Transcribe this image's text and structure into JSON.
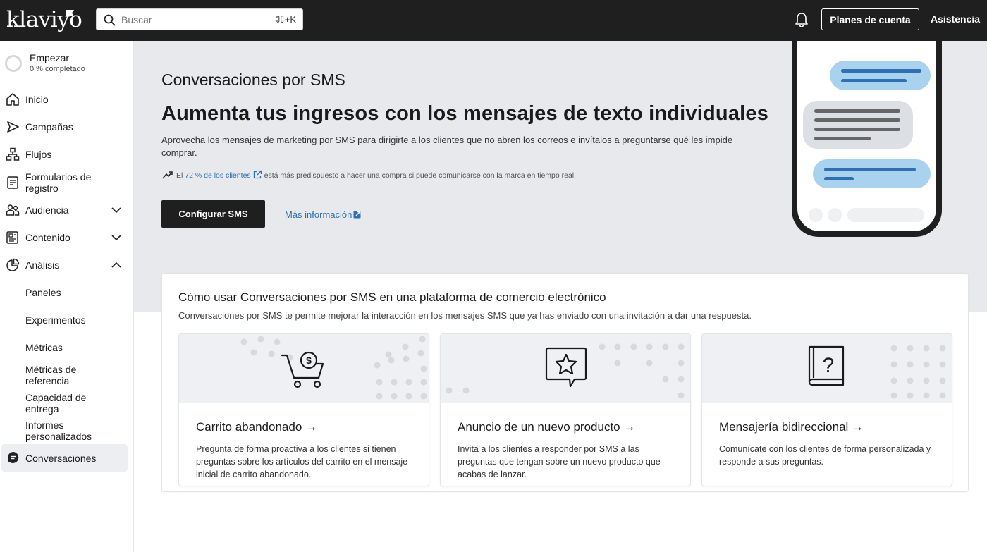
{
  "topbar": {
    "logo": "klaviyo",
    "search_placeholder": "Buscar",
    "search_shortcut": "⌘+K",
    "plans_label": "Planes de cuenta",
    "help_label": "Asistencia"
  },
  "sidebar": {
    "start_title": "Empezar",
    "start_progress": "0 % completado",
    "items": [
      {
        "label": "Inicio"
      },
      {
        "label": "Campañas"
      },
      {
        "label": "Flujos"
      },
      {
        "label": "Formularios de registro"
      },
      {
        "label": "Audiencia"
      },
      {
        "label": "Contenido"
      },
      {
        "label": "Análisis"
      }
    ],
    "sub_items": [
      {
        "label": "Paneles"
      },
      {
        "label": "Experimentos"
      },
      {
        "label": "Métricas"
      },
      {
        "label": "Métricas de referencia"
      },
      {
        "label": "Capacidad de entrega"
      },
      {
        "label": "Informes personalizados"
      }
    ],
    "active_item": "Conversaciones"
  },
  "hero": {
    "subtitle": "Conversaciones por SMS",
    "title": "Aumenta tus ingresos con los mensajes de texto individuales",
    "description": "Aprovecha los mensajes de marketing por SMS para dirigirte a los clientes que no abren los correos e invítalos a preguntarse qué les impide comprar.",
    "stat_prefix": "El",
    "stat_link": "72 % de los clientes",
    "stat_suffix": "está más predispuesto a hacer una compra si puede comunicarse con la marca en tiempo real.",
    "cta_label": "Configurar SMS",
    "more_label": "Más información"
  },
  "howto": {
    "title": "Cómo usar Conversaciones por SMS en una plataforma de comercio electrónico",
    "description": "Conversaciones por SMS te permite mejorar la interacción en los mensajes SMS que ya has enviado con una invitación a dar una respuesta.",
    "cards": [
      {
        "title": "Carrito abandonado →",
        "description": "Pregunta de forma proactiva a los clientes si tienen preguntas sobre los artículos del carrito en el mensaje inicial de carrito abandonado.",
        "icon": "cart-dollar-icon"
      },
      {
        "title": "Anuncio de un nuevo producto →",
        "description": "Invita a los clientes a responder por SMS a las preguntas que tengan sobre un nuevo producto que acabas de lanzar.",
        "icon": "star-message-icon"
      },
      {
        "title": "Mensajería bidireccional →",
        "description": "Comunícate con los clientes de forma personalizada y responde a sus preguntas.",
        "icon": "question-book-icon"
      }
    ]
  },
  "colors": {
    "topbar": "#1f1f1f",
    "hero_bg": "#e7e9ec",
    "link": "#2f6fb3",
    "bubble_blue": "#a9d2ee"
  }
}
